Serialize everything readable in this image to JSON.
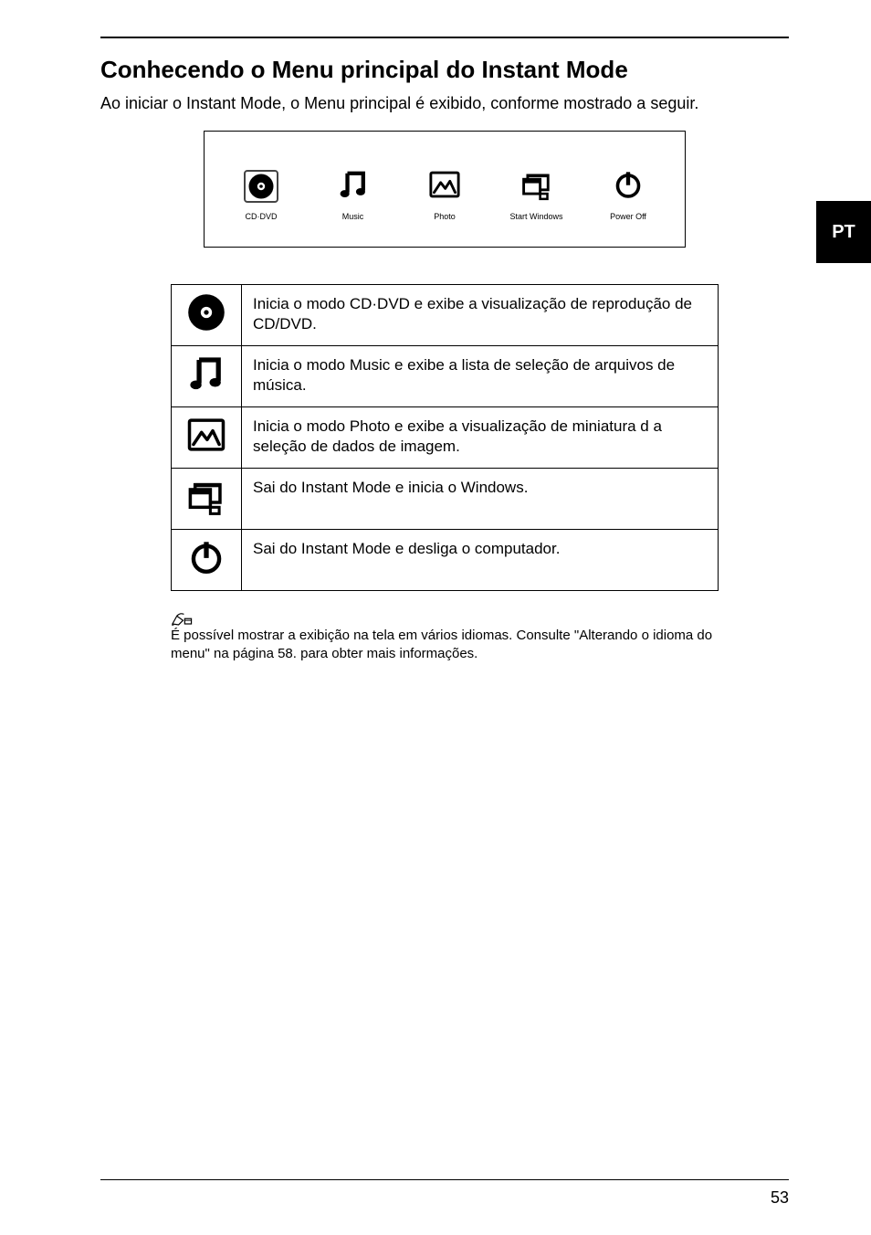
{
  "side_tab": "PT",
  "heading": "Conhecendo o Menu principal do Instant Mode",
  "intro": "Ao iniciar o Instant Mode, o Menu principal é exibido, conforme mostrado a seguir.",
  "menu": {
    "cd_dvd": "CD·DVD",
    "music": "Music",
    "photo": "Photo",
    "start_windows": "Start Windows",
    "power_off": "Power Off"
  },
  "desc": {
    "cd_dvd": "Inicia o modo CD·DVD e exibe a visualização de reprodução de CD/DVD.",
    "music": "Inicia o modo Music e exibe a lista de seleção de arquivos de música.",
    "photo": "Inicia o modo Photo e exibe a visualização de miniatura d a seleção de dados de imagem.",
    "start_windows": "Sai do Instant Mode e inicia o Windows.",
    "power_off": "Sai do Instant Mode e desliga o computador."
  },
  "note": "É possível mostrar a exibição na tela em vários idiomas. Consulte \"Alterando o idioma do menu\" na página 58. para obter mais informações.",
  "page_number": "53"
}
